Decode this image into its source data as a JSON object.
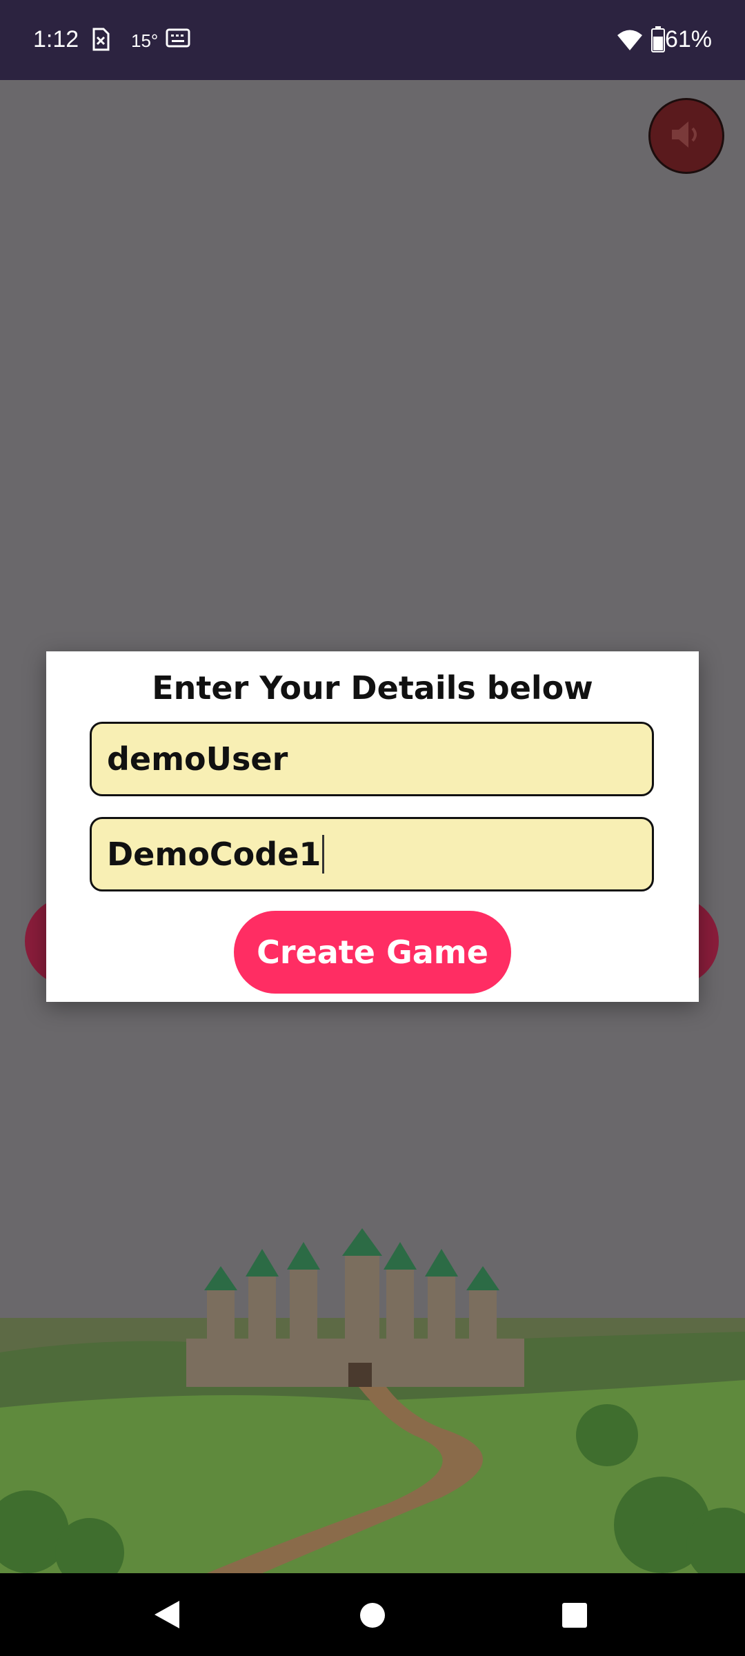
{
  "status_bar": {
    "time": "1:12",
    "temperature": "15°",
    "battery": "61%",
    "icons": [
      "sim-off-icon",
      "keyboard-icon",
      "wifi-icon",
      "battery-icon"
    ]
  },
  "sound_button": {
    "icon": "volume-icon"
  },
  "dialog": {
    "title": "Enter Your Details below",
    "username_value": "demoUser",
    "code_value": "DemoCode1",
    "create_button_label": "Create Game"
  },
  "colors": {
    "status_bar": "#2c2340",
    "overlay": "#6a686b",
    "field_bg": "#f8efb4",
    "button": "#ff2d63",
    "sound_button": "#5a1a1d"
  },
  "nav_bar": {
    "icons": [
      "back-icon",
      "home-icon",
      "recents-icon"
    ]
  }
}
